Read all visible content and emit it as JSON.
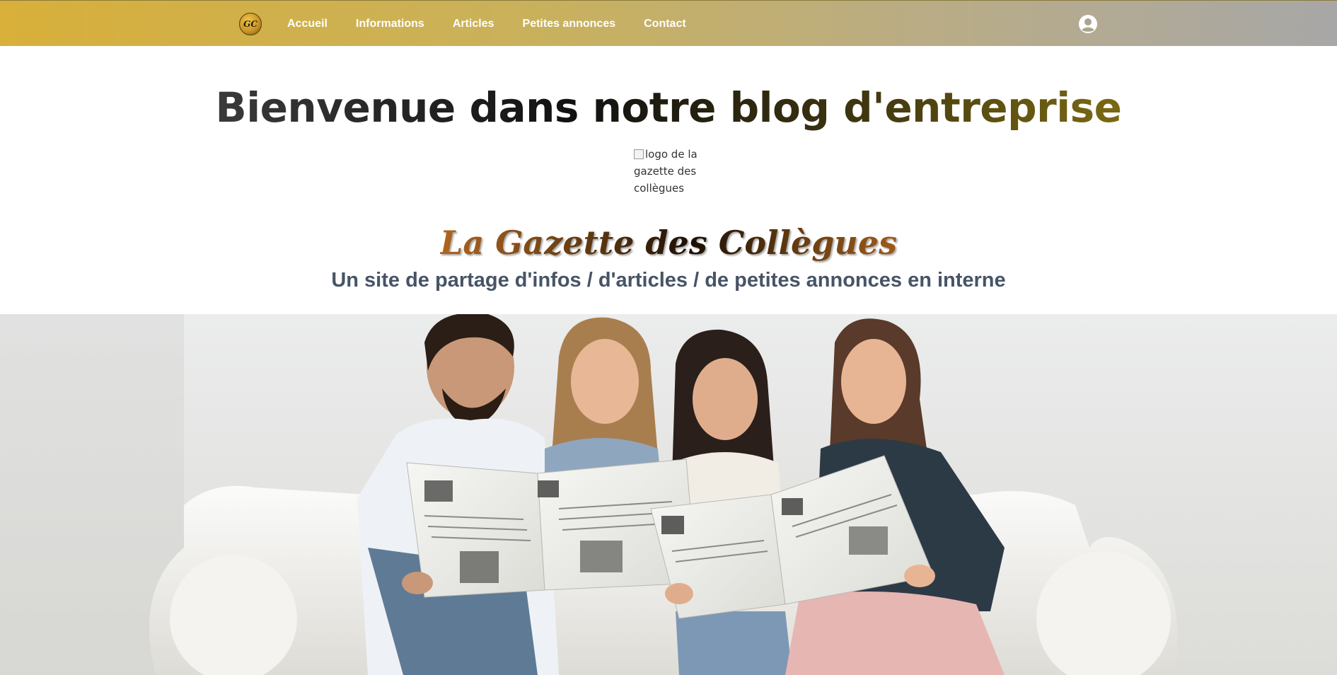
{
  "nav": {
    "logo_text": "GC",
    "links": [
      {
        "label": "Accueil"
      },
      {
        "label": "Informations"
      },
      {
        "label": "Articles"
      },
      {
        "label": "Petites annonces"
      },
      {
        "label": "Contact"
      }
    ],
    "user_icon": "user-circle-icon",
    "gradient_colors": [
      "#d8b03a",
      "#a7a7a7"
    ]
  },
  "header": {
    "title": "Bienvenue dans notre blog d'entreprise",
    "logo_alt": "logo de la gazette des collègues",
    "logo_alt_lines": [
      "logo de la",
      "gazette des",
      "collègues"
    ],
    "gazette_title": "La Gazette des Collègues",
    "subtitle": "Un site de partage d'infos / d'articles / de petites annonces en interne"
  },
  "hero": {
    "description_icon": "people-reading-newspapers-image"
  },
  "colors": {
    "subtitle": "#475466",
    "nav_text": "#ffffff"
  }
}
